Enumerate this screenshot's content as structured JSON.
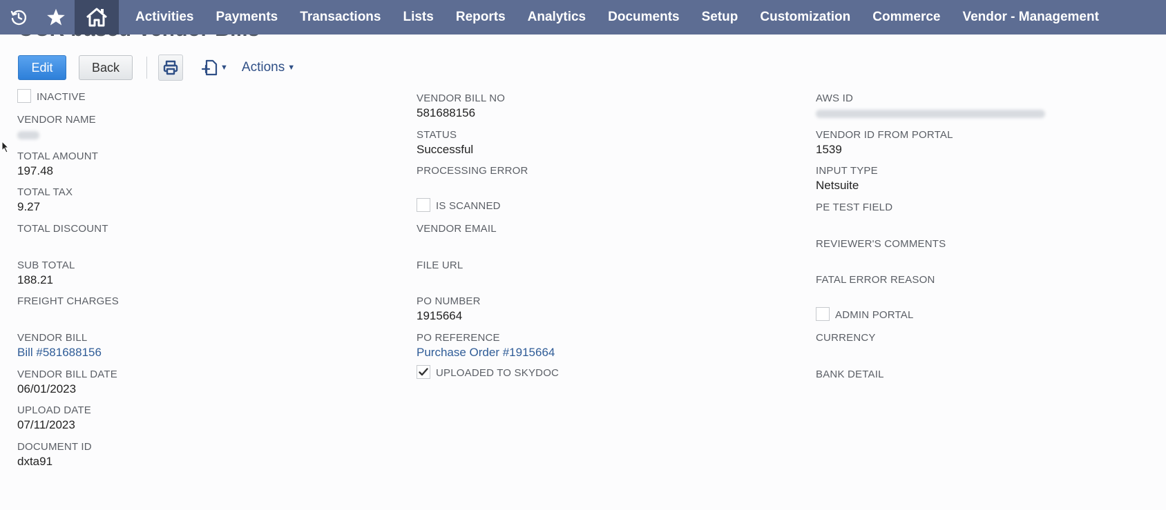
{
  "nav": {
    "items": [
      "Activities",
      "Payments",
      "Transactions",
      "Lists",
      "Reports",
      "Analytics",
      "Documents",
      "Setup",
      "Customization",
      "Commerce",
      "Vendor - Management"
    ]
  },
  "page": {
    "title": "OCR based Vendor Bills"
  },
  "toolbar": {
    "edit_label": "Edit",
    "back_label": "Back",
    "actions_label": "Actions"
  },
  "col1": {
    "inactive_label": "INACTIVE",
    "vendor_name_label": "VENDOR NAME",
    "total_amount_label": "TOTAL AMOUNT",
    "total_amount": "197.48",
    "total_tax_label": "TOTAL TAX",
    "total_tax": "9.27",
    "total_discount_label": "TOTAL DISCOUNT",
    "sub_total_label": "SUB TOTAL",
    "sub_total": "188.21",
    "freight_label": "FREIGHT CHARGES",
    "vendor_bill_label": "VENDOR BILL",
    "vendor_bill": "Bill #581688156",
    "vendor_bill_date_label": "VENDOR BILL DATE",
    "vendor_bill_date": "06/01/2023",
    "upload_date_label": "UPLOAD DATE",
    "upload_date": "07/11/2023",
    "document_id_label": "DOCUMENT ID",
    "document_id": "dxta91"
  },
  "col2": {
    "vendor_bill_no_label": "VENDOR BILL NO",
    "vendor_bill_no": "581688156",
    "status_label": "STATUS",
    "status": "Successful",
    "processing_error_label": "PROCESSING ERROR",
    "is_scanned_label": "IS SCANNED",
    "vendor_email_label": "VENDOR EMAIL",
    "file_url_label": "FILE URL",
    "po_number_label": "PO NUMBER",
    "po_number": "1915664",
    "po_reference_label": "PO REFERENCE",
    "po_reference": "Purchase Order #1915664",
    "uploaded_label": "UPLOADED TO SKYDOC"
  },
  "col3": {
    "aws_id_label": "AWS ID",
    "vendor_id_portal_label": "VENDOR ID FROM PORTAL",
    "vendor_id_portal": "1539",
    "input_type_label": "INPUT TYPE",
    "input_type": "Netsuite",
    "pe_test_label": "PE TEST FIELD",
    "reviewers_label": "REVIEWER'S COMMENTS",
    "fatal_error_label": "FATAL ERROR REASON",
    "admin_portal_label": "ADMIN PORTAL",
    "currency_label": "CURRENCY",
    "bank_detail_label": "BANK DETAIL"
  }
}
